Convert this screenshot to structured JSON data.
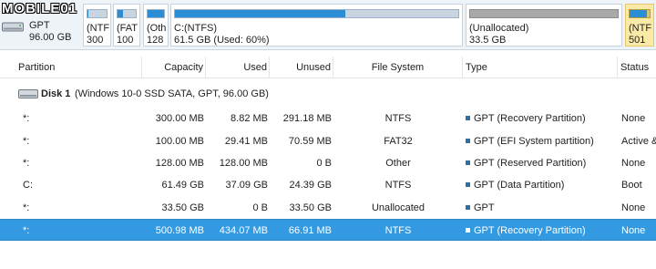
{
  "watermark": "MOBILE01",
  "disk_map": {
    "disk": {
      "name": "GPT",
      "size": "96.00 GB"
    },
    "partitions": [
      {
        "label": "(NTF",
        "size": "300",
        "used_fraction": 0.03,
        "style": "normal"
      },
      {
        "label": "(FAT",
        "size": "100",
        "used_fraction": 0.29,
        "style": "normal"
      },
      {
        "label": "(Oth",
        "size": "128",
        "used_fraction": 1.0,
        "style": "normal"
      },
      {
        "label": "C:(NTFS)",
        "size": "61.5 GB (Used: 60%)",
        "used_fraction": 0.6,
        "style": "normal"
      },
      {
        "label": "(Unallocated)",
        "size": "33.5 GB",
        "used_fraction": 0,
        "style": "unalloc"
      },
      {
        "label": "(NTF",
        "size": "501",
        "used_fraction": 0.87,
        "style": "selected"
      }
    ]
  },
  "table": {
    "columns": [
      "Partition",
      "Capacity",
      "Used",
      "Unused",
      "File System",
      "Type",
      "Status"
    ],
    "disk_row": {
      "name": "Disk 1",
      "description": "(Windows 10-0 SSD SATA, GPT, 96.00 GB)"
    },
    "rows": [
      {
        "partition": "*:",
        "capacity": "300.00 MB",
        "used": "8.82 MB",
        "unused": "291.18 MB",
        "fs": "NTFS",
        "type": "GPT (Recovery Partition)",
        "status": "None",
        "selected": false
      },
      {
        "partition": "*:",
        "capacity": "100.00 MB",
        "used": "29.41 MB",
        "unused": "70.59 MB",
        "fs": "FAT32",
        "type": "GPT (EFI System partition)",
        "status": "Active &",
        "selected": false
      },
      {
        "partition": "*:",
        "capacity": "128.00 MB",
        "used": "128.00 MB",
        "unused": "0 B",
        "fs": "Other",
        "type": "GPT (Reserved Partition)",
        "status": "None",
        "selected": false
      },
      {
        "partition": "C:",
        "capacity": "61.49 GB",
        "used": "37.09 GB",
        "unused": "24.39 GB",
        "fs": "NTFS",
        "type": "GPT (Data Partition)",
        "status": "Boot",
        "selected": false
      },
      {
        "partition": "*:",
        "capacity": "33.50 GB",
        "used": "0 B",
        "unused": "33.50 GB",
        "fs": "Unallocated",
        "type": "GPT",
        "status": "None",
        "selected": false
      },
      {
        "partition": "*:",
        "capacity": "500.98 MB",
        "used": "434.07 MB",
        "unused": "66.91 MB",
        "fs": "NTFS",
        "type": "GPT (Recovery Partition)",
        "status": "None",
        "selected": true
      }
    ]
  },
  "colors": {
    "accent": "#3399e0",
    "bar_fill": "#2b8ed4",
    "unallocated": "#a9a9a9",
    "selected_tile": "#fbe9a8"
  }
}
